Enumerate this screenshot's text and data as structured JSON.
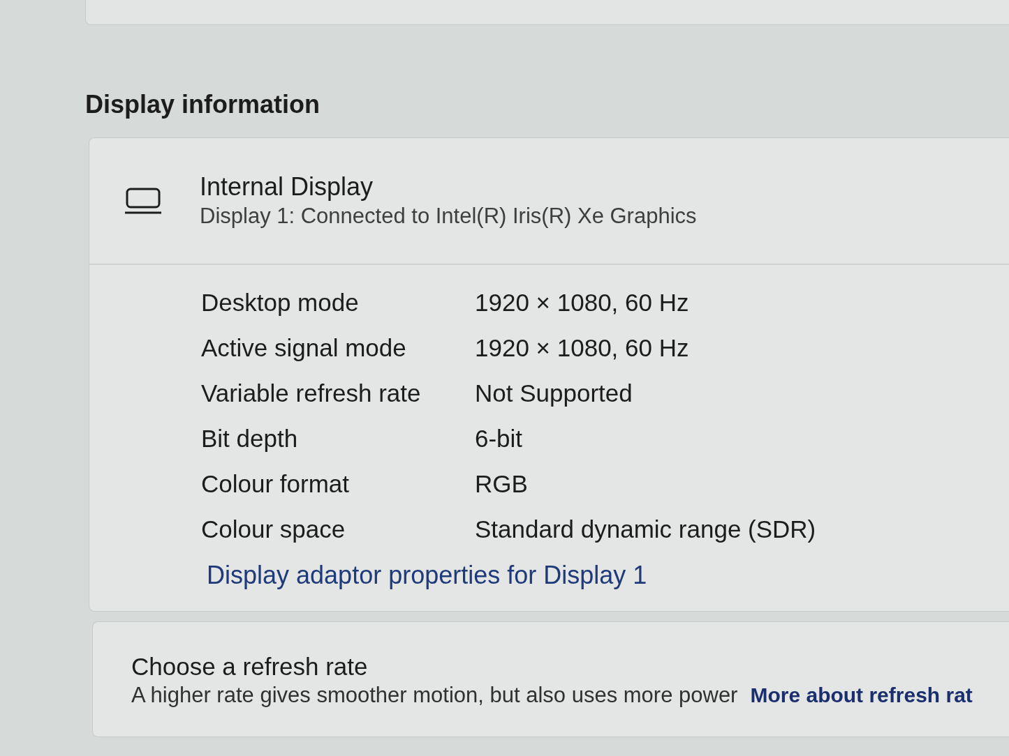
{
  "section_title": "Display information",
  "display_card": {
    "title": "Internal Display",
    "subtitle": "Display 1: Connected to Intel(R) Iris(R) Xe Graphics",
    "details": [
      {
        "label": "Desktop mode",
        "value": "1920 × 1080, 60 Hz"
      },
      {
        "label": "Active signal mode",
        "value": "1920 × 1080, 60 Hz"
      },
      {
        "label": "Variable refresh rate",
        "value": "Not Supported"
      },
      {
        "label": "Bit depth",
        "value": "6-bit"
      },
      {
        "label": "Colour format",
        "value": "RGB"
      },
      {
        "label": "Colour space",
        "value": "Standard dynamic range (SDR)"
      }
    ],
    "link": "Display adaptor properties for Display 1"
  },
  "refresh_rate_card": {
    "title": "Choose a refresh rate",
    "description": "A higher rate gives smoother motion, but also uses more power",
    "link": "More about refresh rat"
  }
}
